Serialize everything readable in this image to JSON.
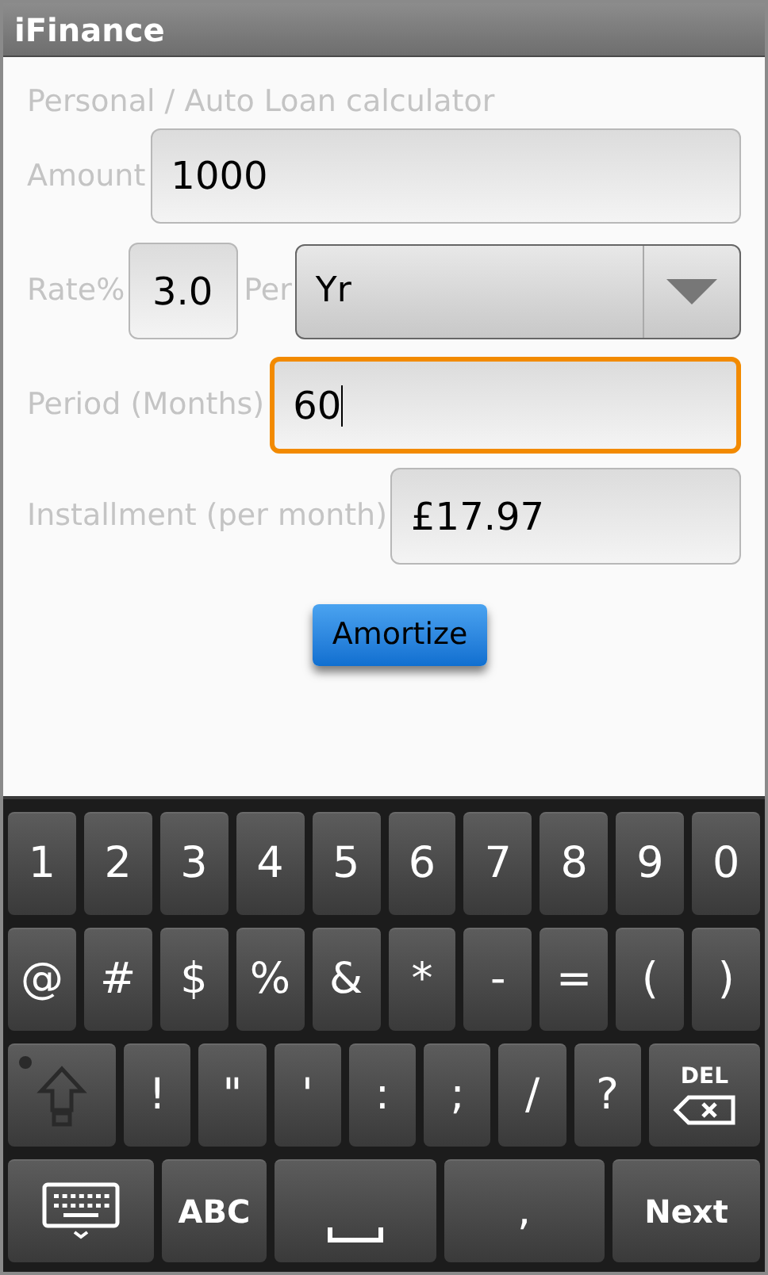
{
  "window": {
    "title": "iFinance"
  },
  "form": {
    "heading": "Personal / Auto Loan calculator",
    "amount": {
      "label": "Amount",
      "value": "1000",
      "focused": false
    },
    "rate": {
      "label": "Rate%",
      "value": "3.0",
      "focused": false
    },
    "per": {
      "label": "Per",
      "value": "Yr"
    },
    "period": {
      "label": "Period (Months)",
      "value": "60",
      "focused": true
    },
    "installment": {
      "label": "Installment (per month)",
      "value": "£17.97",
      "focused": false
    },
    "button": "Amortize"
  },
  "keyboard": {
    "digit_keys": [
      {
        "kind": "char",
        "label": "1"
      },
      {
        "kind": "char",
        "label": "2"
      },
      {
        "kind": "char",
        "label": "3"
      },
      {
        "kind": "char",
        "label": "4"
      },
      {
        "kind": "char",
        "label": "5"
      },
      {
        "kind": "char",
        "label": "6"
      },
      {
        "kind": "char",
        "label": "7"
      },
      {
        "kind": "char",
        "label": "8"
      },
      {
        "kind": "char",
        "label": "9"
      },
      {
        "kind": "char",
        "label": "0"
      }
    ],
    "symbol_keys": [
      {
        "kind": "char",
        "label": "@"
      },
      {
        "kind": "char",
        "label": "#"
      },
      {
        "kind": "char",
        "label": "$"
      },
      {
        "kind": "char",
        "label": "%"
      },
      {
        "kind": "char",
        "label": "&"
      },
      {
        "kind": "char",
        "label": "*"
      },
      {
        "kind": "char",
        "label": "-"
      },
      {
        "kind": "char",
        "label": "="
      },
      {
        "kind": "char",
        "label": "("
      },
      {
        "kind": "char",
        "label": ")"
      }
    ],
    "punctuation_keys": [
      {
        "kind": "shift",
        "on": false
      },
      {
        "kind": "char",
        "label": "!"
      },
      {
        "kind": "char",
        "label": "\""
      },
      {
        "kind": "char",
        "label": "'"
      },
      {
        "kind": "char",
        "label": ":"
      },
      {
        "kind": "char",
        "label": ";"
      },
      {
        "kind": "char",
        "label": "/"
      },
      {
        "kind": "char",
        "label": "?"
      },
      {
        "kind": "delete",
        "label": "DEL"
      }
    ],
    "bottom_keys": [
      {
        "kind": "keyboard"
      },
      {
        "kind": "text",
        "label": "ABC"
      },
      {
        "kind": "space"
      },
      {
        "kind": "char",
        "label": ","
      },
      {
        "kind": "text",
        "label": "Next"
      }
    ]
  }
}
